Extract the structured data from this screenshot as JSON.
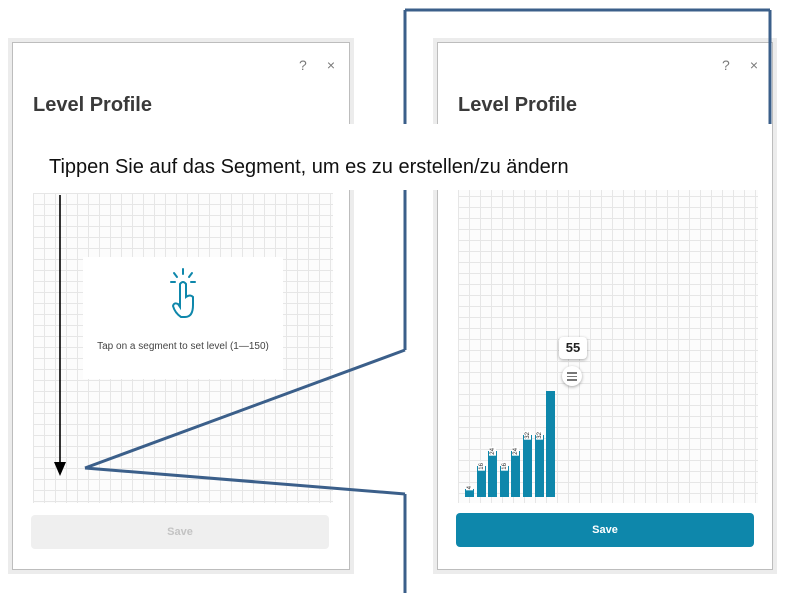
{
  "left_dialog": {
    "help_icon": "?",
    "close_icon": "×",
    "title": "Level Profile",
    "hint": "Tap on a segment to set level (1—150)",
    "save_label": "Save"
  },
  "right_dialog": {
    "help_icon": "?",
    "close_icon": "×",
    "title": "Level Profile",
    "selected_value": "55",
    "save_label": "Save",
    "bar_values": [
      4,
      16,
      24,
      16,
      24,
      32,
      32,
      55
    ],
    "bar_labels": [
      "4",
      "16",
      "24",
      "16",
      "24",
      "32",
      "32"
    ]
  },
  "banner": {
    "text": "Tippen Sie auf das Segment, um es zu erstellen/zu ändern"
  },
  "colors": {
    "accent": "#0e87ab",
    "annotation": "#3b5f8a"
  }
}
